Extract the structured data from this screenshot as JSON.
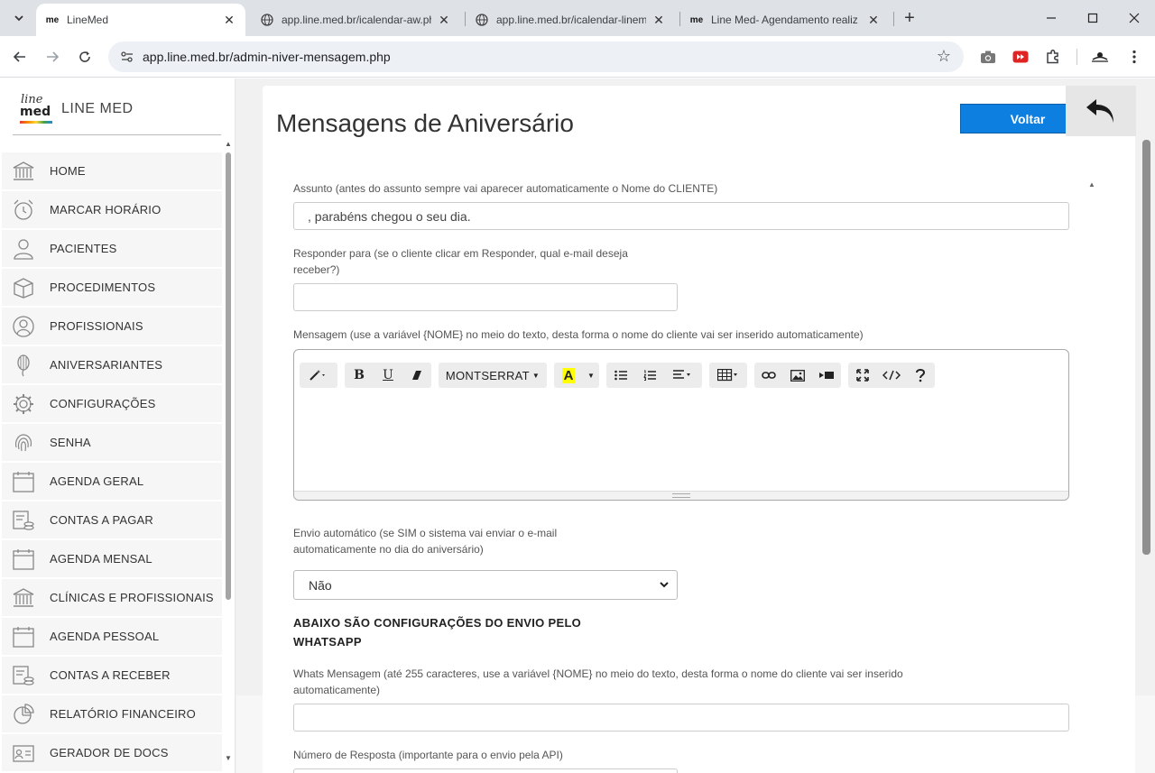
{
  "browser": {
    "tabs": [
      {
        "favicon": "me",
        "title": "LineMed",
        "active": true
      },
      {
        "favicon": "globe-icon",
        "title": "app.line.med.br/icalendar-aw.ph",
        "active": false
      },
      {
        "favicon": "globe-icon",
        "title": "app.line.med.br/icalendar-linem",
        "active": false
      },
      {
        "favicon": "me",
        "title": "Line Med- Agendamento realiz",
        "active": false
      }
    ],
    "url": "app.line.med.br/admin-niver-mensagem.php"
  },
  "sidebar": {
    "brand_logo_top": "line",
    "brand_logo_bottom": "med",
    "brand_name": "LINE MED",
    "items": [
      {
        "label": "HOME",
        "icon": "bank-icon"
      },
      {
        "label": "MARCAR HORÁRIO",
        "icon": "alarm-clock-icon"
      },
      {
        "label": "PACIENTES",
        "icon": "user-icon"
      },
      {
        "label": "PROCEDIMENTOS",
        "icon": "box-icon"
      },
      {
        "label": "PROFISSIONAIS",
        "icon": "user-circle-icon"
      },
      {
        "label": "ANIVERSARIANTES",
        "icon": "balloon-icon"
      },
      {
        "label": "CONFIGURAÇÕES",
        "icon": "gear-icon"
      },
      {
        "label": "SENHA",
        "icon": "fingerprint-icon"
      },
      {
        "label": "AGENDA GERAL",
        "icon": "calendar-icon"
      },
      {
        "label": "CONTAS A PAGAR",
        "icon": "bill-coins-icon"
      },
      {
        "label": "AGENDA MENSAL",
        "icon": "calendar-icon"
      },
      {
        "label": "CLÍNICAS E PROFISSIONAIS",
        "icon": "bank-icon"
      },
      {
        "label": "AGENDA PESSOAL",
        "icon": "calendar-icon"
      },
      {
        "label": "CONTAS A RECEBER",
        "icon": "bill-coins-icon"
      },
      {
        "label": "RELATÓRIO FINANCEIRO",
        "icon": "pie-chart-icon"
      },
      {
        "label": "GERADOR DE DOCS",
        "icon": "id-card-icon"
      }
    ]
  },
  "main": {
    "title": "Mensagens de Aniversário",
    "voltar_label": "Voltar",
    "assunto_label": "Assunto (antes do assunto sempre vai aparecer automaticamente o Nome do CLIENTE)",
    "assunto_value": ", parabéns chegou o seu dia.",
    "responder_label_1": "Responder para (se o cliente clicar em Responder, qual e-mail deseja",
    "responder_label_2": "receber?)",
    "responder_value": "",
    "mensagem_label": "Mensagem (use a variável {NOME} no meio do texto, desta forma o nome do cliente vai ser inserido automaticamente)",
    "editor_font": "MONTSERRAT",
    "envio_label_1": "Envio automático (se SIM o sistema vai enviar o e-mail",
    "envio_label_2": "automaticamente no dia do aniversário)",
    "envio_value": "Não",
    "whatsapp_heading_1": "ABAIXO SÃO CONFIGURAÇÕES DO ENVIO PELO",
    "whatsapp_heading_2": "WHATSAPP",
    "whats_label_1": "Whats Mensagem (até 255 caracteres, use a variável {NOME} no meio do texto, desta forma o nome do cliente vai ser inserido",
    "whats_label_2": "automaticamente)",
    "whats_value": "",
    "numero_label": "Número de Resposta (importante para o envio pela API)"
  },
  "colors": {
    "accent": "#0d7fe0",
    "sidebar_item_bg": "#f6f6f6",
    "page_bg": "#f1f1f1"
  }
}
